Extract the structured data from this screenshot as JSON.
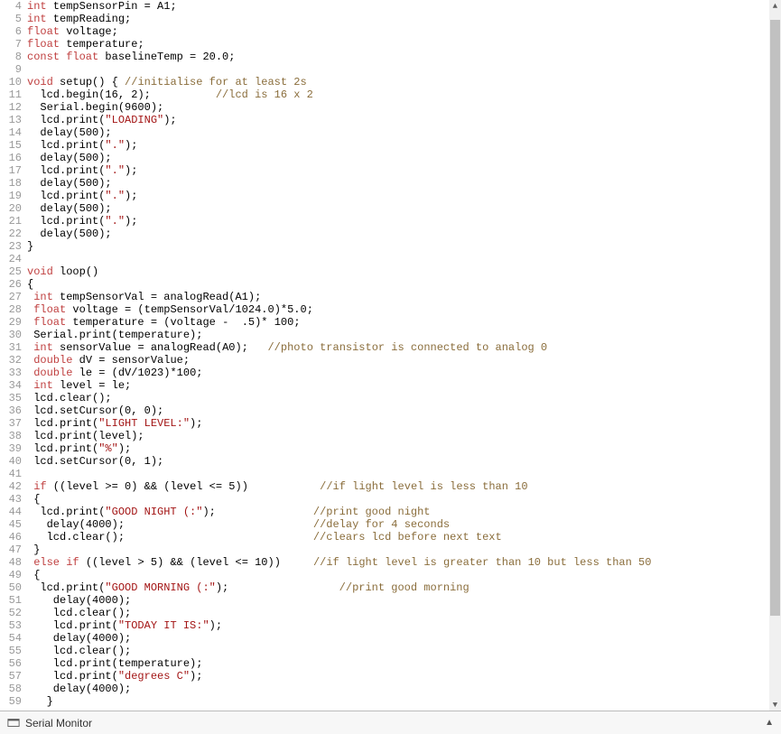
{
  "footer": {
    "label": "Serial Monitor"
  },
  "first_line_number": 4,
  "lines": [
    {
      "n": 4,
      "tokens": [
        {
          "t": "kw",
          "v": "int"
        },
        {
          "t": "id",
          "v": " tempSensorPin "
        },
        {
          "t": "op",
          "v": "= "
        },
        {
          "t": "id",
          "v": "A1"
        },
        {
          "t": "op",
          "v": ";"
        }
      ]
    },
    {
      "n": 5,
      "tokens": [
        {
          "t": "kw",
          "v": "int"
        },
        {
          "t": "id",
          "v": " tempReading"
        },
        {
          "t": "op",
          "v": ";"
        }
      ]
    },
    {
      "n": 6,
      "tokens": [
        {
          "t": "kw",
          "v": "float"
        },
        {
          "t": "id",
          "v": " voltage"
        },
        {
          "t": "op",
          "v": ";"
        }
      ]
    },
    {
      "n": 7,
      "tokens": [
        {
          "t": "kw",
          "v": "float"
        },
        {
          "t": "id",
          "v": " temperature"
        },
        {
          "t": "op",
          "v": ";"
        }
      ]
    },
    {
      "n": 8,
      "tokens": [
        {
          "t": "kw",
          "v": "const float"
        },
        {
          "t": "id",
          "v": " baselineTemp "
        },
        {
          "t": "op",
          "v": "= "
        },
        {
          "t": "num",
          "v": "20.0"
        },
        {
          "t": "op",
          "v": ";"
        }
      ]
    },
    {
      "n": 9,
      "tokens": []
    },
    {
      "n": 10,
      "tokens": [
        {
          "t": "kw",
          "v": "void"
        },
        {
          "t": "id",
          "v": " setup"
        },
        {
          "t": "op",
          "v": "() { "
        },
        {
          "t": "cm",
          "v": "//initialise for at least 2s"
        }
      ]
    },
    {
      "n": 11,
      "tokens": [
        {
          "t": "id",
          "v": "  lcd.begin"
        },
        {
          "t": "op",
          "v": "("
        },
        {
          "t": "num",
          "v": "16"
        },
        {
          "t": "op",
          "v": ", "
        },
        {
          "t": "num",
          "v": "2"
        },
        {
          "t": "op",
          "v": ");          "
        },
        {
          "t": "cm",
          "v": "//lcd is 16 x 2"
        }
      ]
    },
    {
      "n": 12,
      "tokens": [
        {
          "t": "id",
          "v": "  Serial.begin"
        },
        {
          "t": "op",
          "v": "("
        },
        {
          "t": "num",
          "v": "9600"
        },
        {
          "t": "op",
          "v": ");"
        }
      ]
    },
    {
      "n": 13,
      "tokens": [
        {
          "t": "id",
          "v": "  lcd.print"
        },
        {
          "t": "op",
          "v": "("
        },
        {
          "t": "str",
          "v": "\"LOADING\""
        },
        {
          "t": "op",
          "v": ");"
        }
      ]
    },
    {
      "n": 14,
      "tokens": [
        {
          "t": "id",
          "v": "  delay"
        },
        {
          "t": "op",
          "v": "("
        },
        {
          "t": "num",
          "v": "500"
        },
        {
          "t": "op",
          "v": ");"
        }
      ]
    },
    {
      "n": 15,
      "tokens": [
        {
          "t": "id",
          "v": "  lcd.print"
        },
        {
          "t": "op",
          "v": "("
        },
        {
          "t": "str",
          "v": "\".\""
        },
        {
          "t": "op",
          "v": ");"
        }
      ]
    },
    {
      "n": 16,
      "tokens": [
        {
          "t": "id",
          "v": "  delay"
        },
        {
          "t": "op",
          "v": "("
        },
        {
          "t": "num",
          "v": "500"
        },
        {
          "t": "op",
          "v": ");"
        }
      ]
    },
    {
      "n": 17,
      "tokens": [
        {
          "t": "id",
          "v": "  lcd.print"
        },
        {
          "t": "op",
          "v": "("
        },
        {
          "t": "str",
          "v": "\".\""
        },
        {
          "t": "op",
          "v": ");"
        }
      ]
    },
    {
      "n": 18,
      "tokens": [
        {
          "t": "id",
          "v": "  delay"
        },
        {
          "t": "op",
          "v": "("
        },
        {
          "t": "num",
          "v": "500"
        },
        {
          "t": "op",
          "v": ");"
        }
      ]
    },
    {
      "n": 19,
      "tokens": [
        {
          "t": "id",
          "v": "  lcd.print"
        },
        {
          "t": "op",
          "v": "("
        },
        {
          "t": "str",
          "v": "\".\""
        },
        {
          "t": "op",
          "v": ");"
        }
      ]
    },
    {
      "n": 20,
      "tokens": [
        {
          "t": "id",
          "v": "  delay"
        },
        {
          "t": "op",
          "v": "("
        },
        {
          "t": "num",
          "v": "500"
        },
        {
          "t": "op",
          "v": ");"
        }
      ]
    },
    {
      "n": 21,
      "tokens": [
        {
          "t": "id",
          "v": "  lcd.print"
        },
        {
          "t": "op",
          "v": "("
        },
        {
          "t": "str",
          "v": "\".\""
        },
        {
          "t": "op",
          "v": ");"
        }
      ]
    },
    {
      "n": 22,
      "tokens": [
        {
          "t": "id",
          "v": "  delay"
        },
        {
          "t": "op",
          "v": "("
        },
        {
          "t": "num",
          "v": "500"
        },
        {
          "t": "op",
          "v": ");"
        }
      ]
    },
    {
      "n": 23,
      "tokens": [
        {
          "t": "op",
          "v": "}"
        }
      ]
    },
    {
      "n": 24,
      "tokens": []
    },
    {
      "n": 25,
      "tokens": [
        {
          "t": "kw",
          "v": "void"
        },
        {
          "t": "id",
          "v": " loop"
        },
        {
          "t": "op",
          "v": "()"
        }
      ]
    },
    {
      "n": 26,
      "tokens": [
        {
          "t": "op",
          "v": "{"
        }
      ]
    },
    {
      "n": 27,
      "tokens": [
        {
          "t": "id",
          "v": " "
        },
        {
          "t": "kw",
          "v": "int"
        },
        {
          "t": "id",
          "v": " tempSensorVal "
        },
        {
          "t": "op",
          "v": "= "
        },
        {
          "t": "id",
          "v": "analogRead"
        },
        {
          "t": "op",
          "v": "("
        },
        {
          "t": "id",
          "v": "A1"
        },
        {
          "t": "op",
          "v": ");"
        }
      ]
    },
    {
      "n": 28,
      "tokens": [
        {
          "t": "id",
          "v": " "
        },
        {
          "t": "kw",
          "v": "float"
        },
        {
          "t": "id",
          "v": " voltage "
        },
        {
          "t": "op",
          "v": "= ("
        },
        {
          "t": "id",
          "v": "tempSensorVal"
        },
        {
          "t": "op",
          "v": "/"
        },
        {
          "t": "num",
          "v": "1024.0"
        },
        {
          "t": "op",
          "v": ")*"
        },
        {
          "t": "num",
          "v": "5.0"
        },
        {
          "t": "op",
          "v": ";"
        }
      ]
    },
    {
      "n": 29,
      "tokens": [
        {
          "t": "id",
          "v": " "
        },
        {
          "t": "kw",
          "v": "float"
        },
        {
          "t": "id",
          "v": " temperature "
        },
        {
          "t": "op",
          "v": "= ("
        },
        {
          "t": "id",
          "v": "voltage"
        },
        {
          "t": "op",
          "v": " -  "
        },
        {
          "t": "num",
          "v": ".5"
        },
        {
          "t": "op",
          "v": ")* "
        },
        {
          "t": "num",
          "v": "100"
        },
        {
          "t": "op",
          "v": ";"
        }
      ]
    },
    {
      "n": 30,
      "tokens": [
        {
          "t": "id",
          "v": " Serial.print"
        },
        {
          "t": "op",
          "v": "("
        },
        {
          "t": "id",
          "v": "temperature"
        },
        {
          "t": "op",
          "v": ");"
        }
      ]
    },
    {
      "n": 31,
      "tokens": [
        {
          "t": "id",
          "v": " "
        },
        {
          "t": "kw",
          "v": "int"
        },
        {
          "t": "id",
          "v": " sensorValue "
        },
        {
          "t": "op",
          "v": "= "
        },
        {
          "t": "id",
          "v": "analogRead"
        },
        {
          "t": "op",
          "v": "("
        },
        {
          "t": "id",
          "v": "A0"
        },
        {
          "t": "op",
          "v": ");   "
        },
        {
          "t": "cm",
          "v": "//photo transistor is connected to analog 0"
        }
      ]
    },
    {
      "n": 32,
      "tokens": [
        {
          "t": "id",
          "v": " "
        },
        {
          "t": "kw",
          "v": "double"
        },
        {
          "t": "id",
          "v": " dV "
        },
        {
          "t": "op",
          "v": "= "
        },
        {
          "t": "id",
          "v": "sensorValue"
        },
        {
          "t": "op",
          "v": ";"
        }
      ]
    },
    {
      "n": 33,
      "tokens": [
        {
          "t": "id",
          "v": " "
        },
        {
          "t": "kw",
          "v": "double"
        },
        {
          "t": "id",
          "v": " le "
        },
        {
          "t": "op",
          "v": "= ("
        },
        {
          "t": "id",
          "v": "dV"
        },
        {
          "t": "op",
          "v": "/"
        },
        {
          "t": "num",
          "v": "1023"
        },
        {
          "t": "op",
          "v": ")*"
        },
        {
          "t": "num",
          "v": "100"
        },
        {
          "t": "op",
          "v": ";"
        }
      ]
    },
    {
      "n": 34,
      "tokens": [
        {
          "t": "id",
          "v": " "
        },
        {
          "t": "kw",
          "v": "int"
        },
        {
          "t": "id",
          "v": " level "
        },
        {
          "t": "op",
          "v": "= "
        },
        {
          "t": "id",
          "v": "le"
        },
        {
          "t": "op",
          "v": ";"
        }
      ]
    },
    {
      "n": 35,
      "tokens": [
        {
          "t": "id",
          "v": " lcd.clear"
        },
        {
          "t": "op",
          "v": "();"
        }
      ]
    },
    {
      "n": 36,
      "tokens": [
        {
          "t": "id",
          "v": " lcd.setCursor"
        },
        {
          "t": "op",
          "v": "("
        },
        {
          "t": "num",
          "v": "0"
        },
        {
          "t": "op",
          "v": ", "
        },
        {
          "t": "num",
          "v": "0"
        },
        {
          "t": "op",
          "v": ");"
        }
      ]
    },
    {
      "n": 37,
      "tokens": [
        {
          "t": "id",
          "v": " lcd.print"
        },
        {
          "t": "op",
          "v": "("
        },
        {
          "t": "str",
          "v": "\"LIGHT LEVEL:\""
        },
        {
          "t": "op",
          "v": ");"
        }
      ]
    },
    {
      "n": 38,
      "tokens": [
        {
          "t": "id",
          "v": " lcd.print"
        },
        {
          "t": "op",
          "v": "("
        },
        {
          "t": "id",
          "v": "level"
        },
        {
          "t": "op",
          "v": ");"
        }
      ]
    },
    {
      "n": 39,
      "tokens": [
        {
          "t": "id",
          "v": " lcd.print"
        },
        {
          "t": "op",
          "v": "("
        },
        {
          "t": "str",
          "v": "\"%\""
        },
        {
          "t": "op",
          "v": ");"
        }
      ]
    },
    {
      "n": 40,
      "tokens": [
        {
          "t": "id",
          "v": " lcd.setCursor"
        },
        {
          "t": "op",
          "v": "("
        },
        {
          "t": "num",
          "v": "0"
        },
        {
          "t": "op",
          "v": ", "
        },
        {
          "t": "num",
          "v": "1"
        },
        {
          "t": "op",
          "v": ");"
        }
      ]
    },
    {
      "n": 41,
      "tokens": []
    },
    {
      "n": 42,
      "tokens": [
        {
          "t": "id",
          "v": " "
        },
        {
          "t": "kw",
          "v": "if"
        },
        {
          "t": "op",
          "v": " (("
        },
        {
          "t": "id",
          "v": "level"
        },
        {
          "t": "op",
          "v": " >= "
        },
        {
          "t": "num",
          "v": "0"
        },
        {
          "t": "op",
          "v": ") && ("
        },
        {
          "t": "id",
          "v": "level"
        },
        {
          "t": "op",
          "v": " <= "
        },
        {
          "t": "num",
          "v": "5"
        },
        {
          "t": "op",
          "v": "))           "
        },
        {
          "t": "cm",
          "v": "//if light level is less than 10"
        }
      ]
    },
    {
      "n": 43,
      "tokens": [
        {
          "t": "op",
          "v": " {"
        }
      ]
    },
    {
      "n": 44,
      "tokens": [
        {
          "t": "id",
          "v": "  lcd.print"
        },
        {
          "t": "op",
          "v": "("
        },
        {
          "t": "str",
          "v": "\"GOOD NIGHT (:\""
        },
        {
          "t": "op",
          "v": ");               "
        },
        {
          "t": "cm",
          "v": "//print good night"
        }
      ]
    },
    {
      "n": 45,
      "tokens": [
        {
          "t": "id",
          "v": "   delay"
        },
        {
          "t": "op",
          "v": "("
        },
        {
          "t": "num",
          "v": "4000"
        },
        {
          "t": "op",
          "v": ");                             "
        },
        {
          "t": "cm",
          "v": "//delay for 4 seconds"
        }
      ]
    },
    {
      "n": 46,
      "tokens": [
        {
          "t": "id",
          "v": "   lcd.clear"
        },
        {
          "t": "op",
          "v": "();                             "
        },
        {
          "t": "cm",
          "v": "//clears lcd before next text"
        }
      ]
    },
    {
      "n": 47,
      "tokens": [
        {
          "t": "op",
          "v": " }"
        }
      ]
    },
    {
      "n": 48,
      "tokens": [
        {
          "t": "id",
          "v": " "
        },
        {
          "t": "kw",
          "v": "else if"
        },
        {
          "t": "op",
          "v": " (("
        },
        {
          "t": "id",
          "v": "level"
        },
        {
          "t": "op",
          "v": " > "
        },
        {
          "t": "num",
          "v": "5"
        },
        {
          "t": "op",
          "v": ") && ("
        },
        {
          "t": "id",
          "v": "level"
        },
        {
          "t": "op",
          "v": " <= "
        },
        {
          "t": "num",
          "v": "10"
        },
        {
          "t": "op",
          "v": "))     "
        },
        {
          "t": "cm",
          "v": "//if light level is greater than 10 but less than 50"
        }
      ]
    },
    {
      "n": 49,
      "tokens": [
        {
          "t": "op",
          "v": " {"
        }
      ]
    },
    {
      "n": 50,
      "tokens": [
        {
          "t": "id",
          "v": "  lcd.print"
        },
        {
          "t": "op",
          "v": "("
        },
        {
          "t": "str",
          "v": "\"GOOD MORNING (:\""
        },
        {
          "t": "op",
          "v": ");                 "
        },
        {
          "t": "cm",
          "v": "//print good morning"
        }
      ]
    },
    {
      "n": 51,
      "tokens": [
        {
          "t": "id",
          "v": "    delay"
        },
        {
          "t": "op",
          "v": "("
        },
        {
          "t": "num",
          "v": "4000"
        },
        {
          "t": "op",
          "v": ");"
        }
      ]
    },
    {
      "n": 52,
      "tokens": [
        {
          "t": "id",
          "v": "    lcd.clear"
        },
        {
          "t": "op",
          "v": "();"
        }
      ]
    },
    {
      "n": 53,
      "tokens": [
        {
          "t": "id",
          "v": "    lcd.print"
        },
        {
          "t": "op",
          "v": "("
        },
        {
          "t": "str",
          "v": "\"TODAY IT IS:\""
        },
        {
          "t": "op",
          "v": ");"
        }
      ]
    },
    {
      "n": 54,
      "tokens": [
        {
          "t": "id",
          "v": "    delay"
        },
        {
          "t": "op",
          "v": "("
        },
        {
          "t": "num",
          "v": "4000"
        },
        {
          "t": "op",
          "v": ");"
        }
      ]
    },
    {
      "n": 55,
      "tokens": [
        {
          "t": "id",
          "v": "    lcd.clear"
        },
        {
          "t": "op",
          "v": "();"
        }
      ]
    },
    {
      "n": 56,
      "tokens": [
        {
          "t": "id",
          "v": "    lcd.print"
        },
        {
          "t": "op",
          "v": "("
        },
        {
          "t": "id",
          "v": "temperature"
        },
        {
          "t": "op",
          "v": ");"
        }
      ]
    },
    {
      "n": 57,
      "tokens": [
        {
          "t": "id",
          "v": "    lcd.print"
        },
        {
          "t": "op",
          "v": "("
        },
        {
          "t": "str",
          "v": "\"degrees C\""
        },
        {
          "t": "op",
          "v": ");"
        }
      ]
    },
    {
      "n": 58,
      "tokens": [
        {
          "t": "id",
          "v": "    delay"
        },
        {
          "t": "op",
          "v": "("
        },
        {
          "t": "num",
          "v": "4000"
        },
        {
          "t": "op",
          "v": ");"
        }
      ]
    },
    {
      "n": 59,
      "tokens": [
        {
          "t": "op",
          "v": "   }"
        }
      ]
    }
  ]
}
